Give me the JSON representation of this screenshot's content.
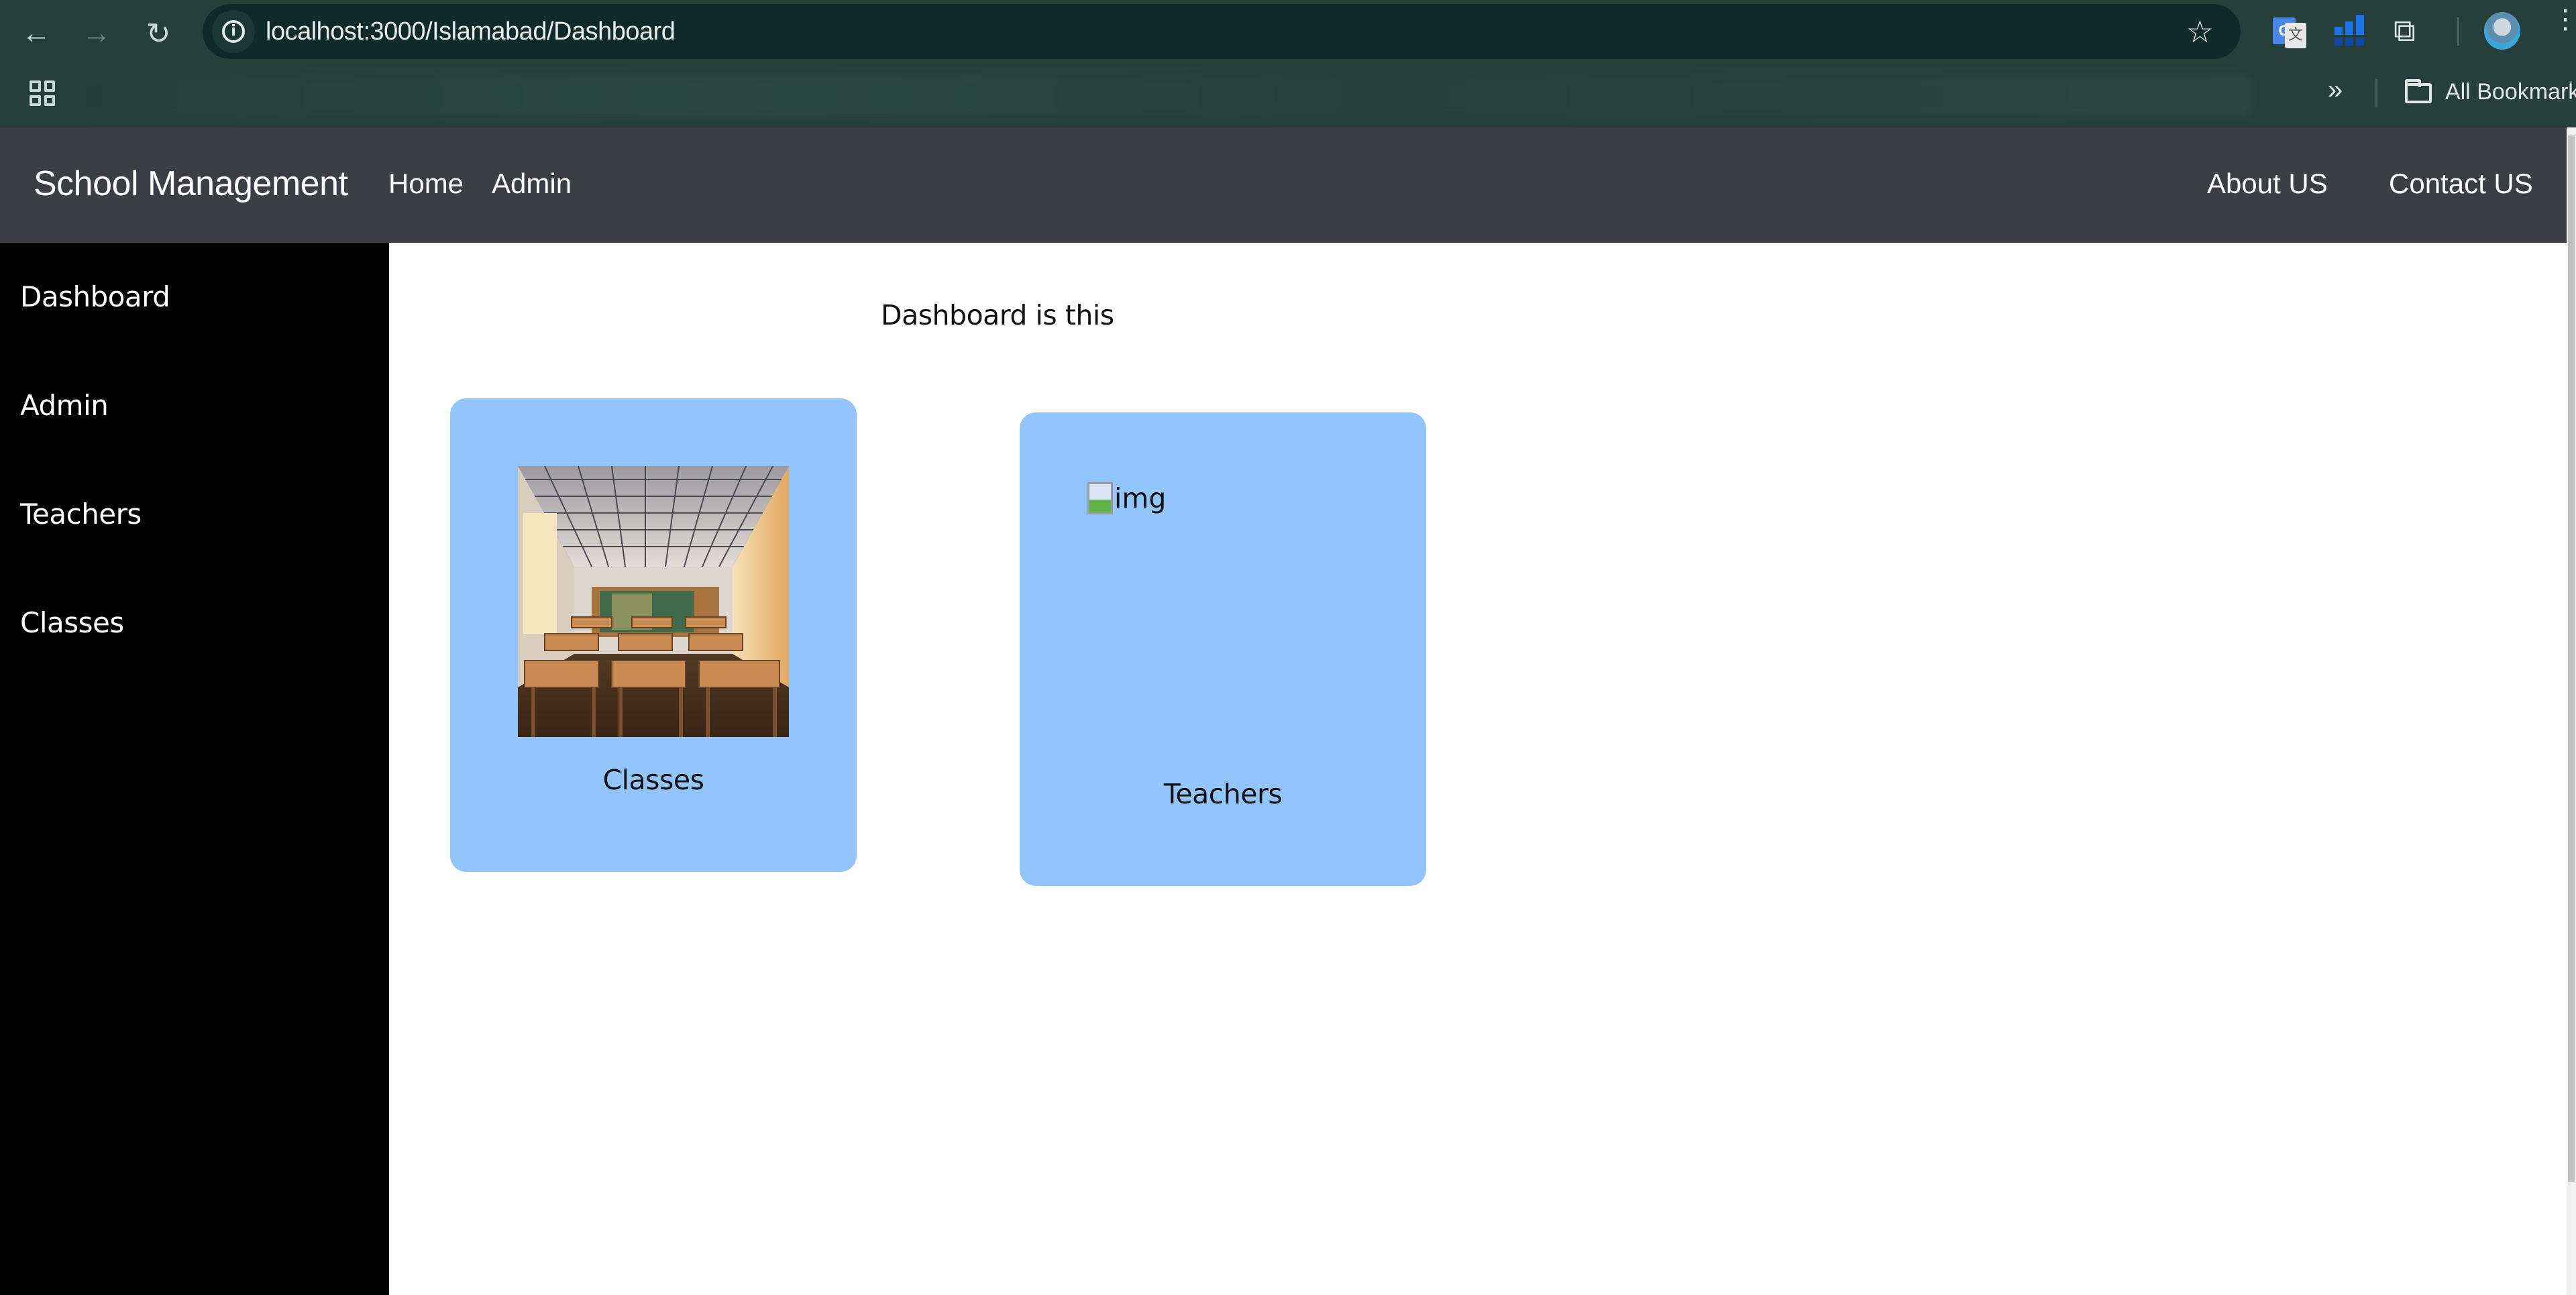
{
  "browser": {
    "url": "localhost:3000/Islamabad/Dashboard",
    "bookmarks_label": "All Bookmarks",
    "icons": {
      "back": "arrow-left-icon",
      "forward": "arrow-right-icon",
      "reload": "reload-icon",
      "site_info": "info-icon",
      "bookmark_star": "star-icon",
      "translate_ext": "google-translate-icon",
      "bars_ext": "bar-chart-extension-icon",
      "extensions": "puzzle-icon",
      "profile": "avatar",
      "menu": "kebab-menu-icon",
      "apps": "apps-grid-icon",
      "overflow": "double-chevron-icon",
      "folder": "folder-icon"
    },
    "glyphs": {
      "back": "←",
      "forward": "→",
      "reload": "↻",
      "info": "i",
      "star": "☆",
      "puzzle": "⧉",
      "menu": "⋮",
      "overflow": "»",
      "translate_g": "G",
      "translate_t": "文"
    }
  },
  "navbar": {
    "brand": "School Management",
    "left_links": [
      "Home",
      "Admin"
    ],
    "right_links": [
      "About US",
      "Contact US"
    ]
  },
  "sidebar": {
    "items": [
      {
        "label": "Dashboard"
      },
      {
        "label": "Admin"
      },
      {
        "label": "Teachers"
      },
      {
        "label": "Classes"
      }
    ]
  },
  "main": {
    "title": "Dashboard is this",
    "cards": [
      {
        "label": "Classes",
        "image": "classroom-photo",
        "image_loaded": true
      },
      {
        "label": "Teachers",
        "image_alt": "img",
        "image_loaded": false
      }
    ]
  },
  "colors": {
    "chrome_bg": "#263f3a",
    "address_bar_bg": "#10292a",
    "navbar_bg": "#3d3e44",
    "sidebar_bg": "#000000",
    "card_bg": "#93c5fd"
  }
}
